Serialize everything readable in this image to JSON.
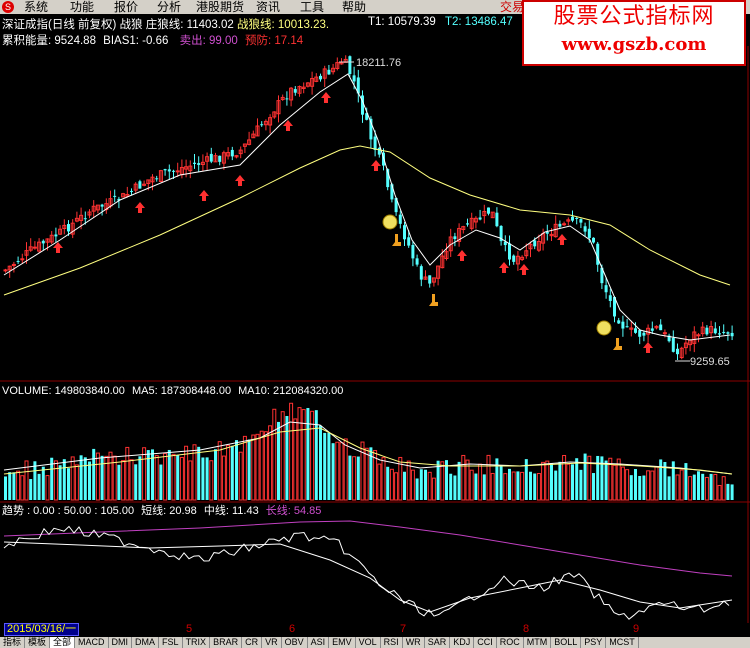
{
  "menu": {
    "logo": "S",
    "items": [
      "系统",
      "功能",
      "报价",
      "分析",
      "港股期货",
      "资讯",
      "工具",
      "帮助"
    ],
    "trade": "交易"
  },
  "watermark": {
    "line1": "股票公式指标网",
    "line2": "www.gszb.com"
  },
  "header": {
    "title": "深证成指(日线 前复权)",
    "indicator": "战狼",
    "zhuang_label": "庄狼线:",
    "zhuang_value": "11403.02",
    "zhanlang_label": "战狼线:",
    "zhanlang_value": "10013.23.",
    "t1": "T1: 10579.39",
    "t2": "T2: 13486.47",
    "t_extra": "T"
  },
  "header2": {
    "energy": "累积能量: 9524.88",
    "bias": "BIAS1: -0.66",
    "sell": "卖出: 99.00",
    "warn": "预防: 17.14"
  },
  "price_labels": {
    "high": "18211.76",
    "low": "9259.65"
  },
  "volume": {
    "label": "VOLUME: 149803840.00",
    "ma5": "MA5: 187308448.00",
    "ma10": "MA10: 212084320.00"
  },
  "trend": {
    "label": "趋势",
    "values": ": 0.00  : 50.00  : 105.00",
    "short": "短线: 20.98",
    "mid": "中线: 11.43",
    "long": "长线: 54.85"
  },
  "datebar": {
    "date": "2015/03/16/一",
    "months": [
      "5",
      "6",
      "7",
      "8",
      "9"
    ]
  },
  "tabs": [
    "指标",
    "模板",
    "全部",
    "MACD",
    "DMI",
    "DMA",
    "FSL",
    "TRIX",
    "BRAR",
    "CR",
    "VR",
    "OBV",
    "ASI",
    "EMV",
    "VOL",
    "RSI",
    "WR",
    "SAR",
    "KDJ",
    "CCI",
    "ROC",
    "MTM",
    "BOLL",
    "PSY",
    "MCST"
  ],
  "colors": {
    "up": "#ff3232",
    "down": "#54ffff",
    "ma_short": "#ffffff",
    "ma_long": "#ffff80",
    "long_line": "#c040c0",
    "grid": "#8b0000"
  }
}
